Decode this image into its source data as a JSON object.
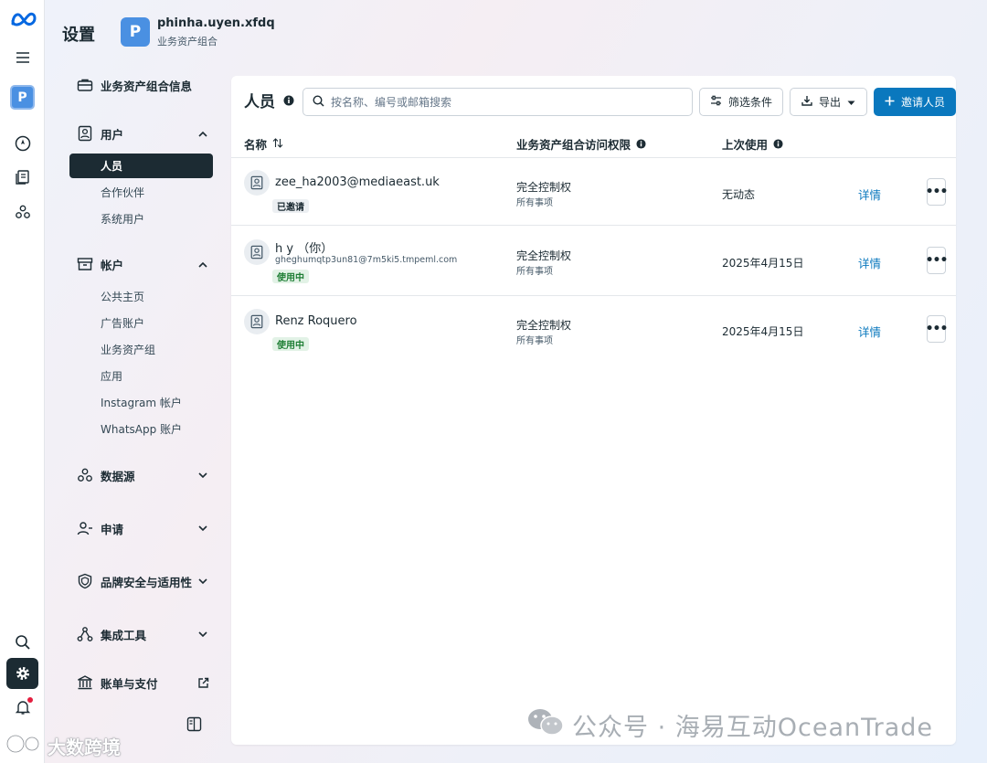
{
  "rail": {
    "logo": "meta-logo",
    "menu_icon": "hamburger-icon",
    "account_initial": "P",
    "nav_icons": [
      "compass-icon",
      "pages-icon",
      "people-network-icon"
    ],
    "bottom_icons": [
      "search-icon",
      "gear-icon",
      "bell-icon"
    ]
  },
  "header": {
    "title": "设置",
    "avatar_initial": "P",
    "account_name": "phinha.uyen.xfdq",
    "account_sub": "业务资产组合"
  },
  "sidebar": {
    "portfolio_info": "业务资产组合信息",
    "users": {
      "label": "用户",
      "items": [
        "人员",
        "合作伙伴",
        "系统用户"
      ],
      "active": "人员"
    },
    "accounts": {
      "label": "帐户",
      "items": [
        "公共主页",
        "广告账户",
        "业务资产组",
        "应用",
        "Instagram 帐户",
        "WhatsApp 账户"
      ]
    },
    "data_sources": "数据源",
    "requests": "申请",
    "brand_safety": "品牌安全与适用性",
    "integrations": "集成工具",
    "billing": "账单与支付"
  },
  "main": {
    "title": "人员",
    "search_placeholder": "按名称、编号或邮箱搜索",
    "filter_label": "筛选条件",
    "export_label": "导出",
    "invite_label": "邀请人员",
    "columns": {
      "name": "名称",
      "access": "业务资产组合访问权限",
      "last_used": "上次使用"
    },
    "rows": [
      {
        "name": "zee_ha2003@mediaeast.uk",
        "email": "",
        "status": "已邀请",
        "access": "完全控制权",
        "scope": "所有事项",
        "last_used": "无动态",
        "details": "详情"
      },
      {
        "name": "h y （你）",
        "email": "gheghumqtp3un81@7m5ki5.tmpeml.com",
        "status": "使用中",
        "access": "完全控制权",
        "scope": "所有事项",
        "last_used": "2025年4月15日",
        "details": "详情"
      },
      {
        "name": "Renz Roquero",
        "email": "",
        "status": "使用中",
        "access": "完全控制权",
        "scope": "所有事项",
        "last_used": "2025年4月15日",
        "details": "详情"
      }
    ]
  },
  "watermarks": {
    "right": "公众号 · 海易互动OceanTrade",
    "left": "大数跨境"
  },
  "colors": {
    "primary": "#0a78be",
    "dark": "#1c2b33",
    "active_badge_bg": "#e2f2e6",
    "active_badge_text": "#1e7e34",
    "avatar_blue": "#4a90e2"
  }
}
